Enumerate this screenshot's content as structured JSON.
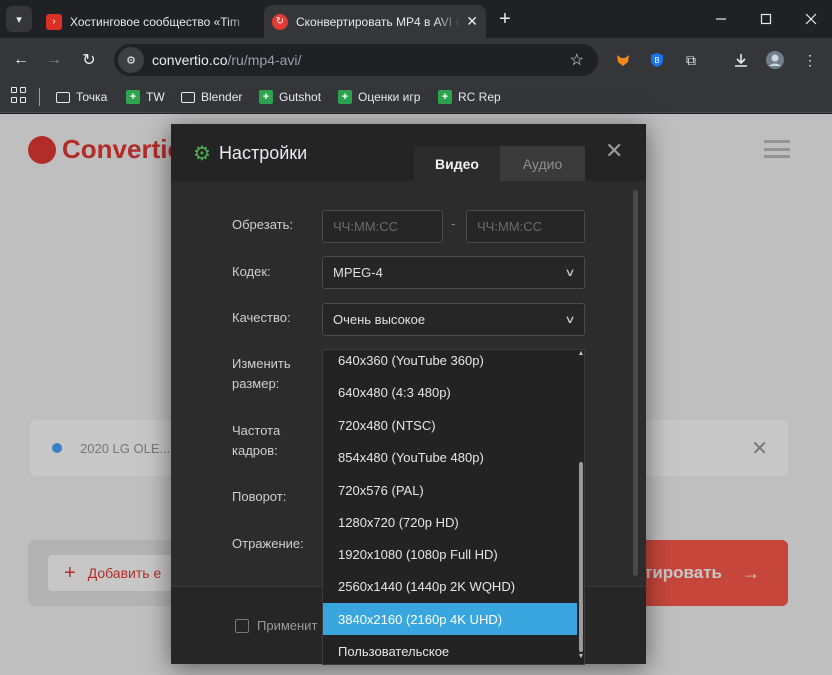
{
  "browser": {
    "tabs": [
      {
        "title": "Хостинговое сообщество «Tim",
        "active": false
      },
      {
        "title": "Сконвертировать MP4 в AVI он",
        "active": true
      }
    ],
    "tab_menu_icon": "chevron-down-icon",
    "new_tab_icon": "plus-icon",
    "url_domain": "convertio.co",
    "url_path": "/ru/mp4-avi/",
    "bookmarks": [
      {
        "label": "Точка",
        "icon": "folder-icon"
      },
      {
        "label": "TW",
        "icon": "green-plus-icon"
      },
      {
        "label": "Blender",
        "icon": "folder-icon"
      },
      {
        "label": "Gutshot",
        "icon": "green-plus-icon"
      },
      {
        "label": "Оценки игр",
        "icon": "green-plus-icon"
      },
      {
        "label": "RC Rep",
        "icon": "green-plus-icon"
      }
    ]
  },
  "page": {
    "logo_text": "Convertio",
    "file_name": "2020 LG OLE...",
    "add_files_label": "Добавить е",
    "convert_label": "тировать"
  },
  "modal": {
    "title": "Настройки",
    "tab_video": "Видео",
    "tab_audio": "Аудио",
    "fields": {
      "trim_label": "Обрезать:",
      "trim_start_placeholder": "ЧЧ:ММ:СС",
      "trim_end_placeholder": "ЧЧ:ММ:СС",
      "codec_label": "Кодек:",
      "codec_value": "MPEG-4",
      "quality_label": "Качество:",
      "quality_value": "Очень высокое",
      "resize_label_line1": "Изменить",
      "resize_label_line2": "размер:",
      "framerate_label_line1": "Частота",
      "framerate_label_line2": "кадров:",
      "rotate_label": "Поворот:",
      "flip_label": "Отражение:"
    },
    "apply_label": "Применит"
  },
  "dropdown": {
    "options": [
      "640x360 (YouTube 360p)",
      "640x480 (4:3 480p)",
      "720x480 (NTSC)",
      "854x480 (YouTube 480p)",
      "720x576 (PAL)",
      "1280x720 (720p HD)",
      "1920x1080 (1080p Full HD)",
      "2560x1440 (1440p 2K WQHD)",
      "3840x2160 (2160p 4K UHD)",
      "Пользовательское"
    ],
    "selected": "3840x2160 (2160p 4K UHD)"
  },
  "colors": {
    "accent_blue": "#3aa6e0",
    "brand_red": "#e53935",
    "settings_green": "#4caf50"
  }
}
